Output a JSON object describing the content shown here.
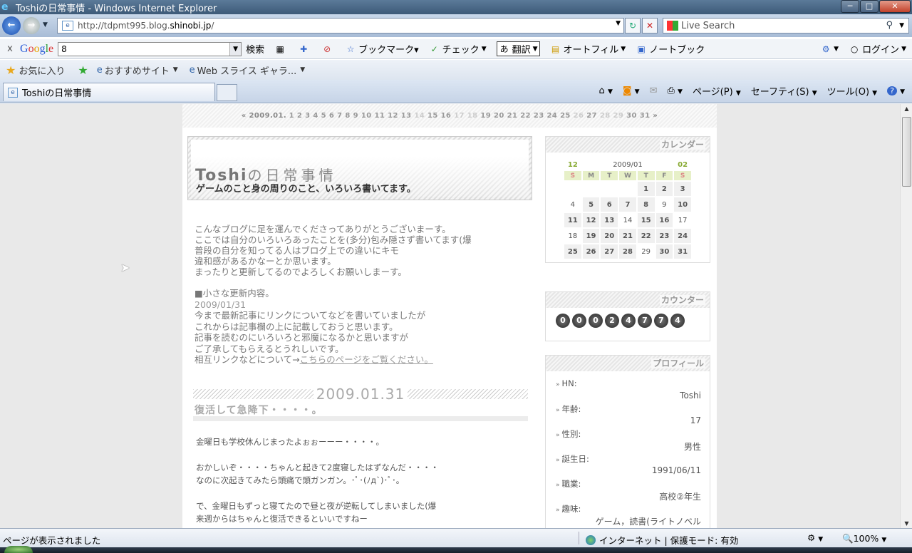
{
  "window": {
    "title": "Toshiの日常事情 - Windows Internet Explorer",
    "minimize": "─",
    "maximize": "□",
    "close": "✕"
  },
  "nav": {
    "url_prefix": "http://tdpmt995.blog.",
    "url_domain": "shinobi.jp",
    "url_suffix": "/",
    "search_placeholder": "Live Search"
  },
  "google_toolbar": {
    "close": "x",
    "select_value": "8",
    "search_label": "検索",
    "bookmark": "ブックマーク▾",
    "check": "チェック",
    "translate": "翻訳",
    "autofill": "オートフィル",
    "notebook": "ノートブック",
    "login": "ログイン"
  },
  "favorites": {
    "favorites_label": "お気に入り",
    "suggested_sites": "おすすめサイト",
    "web_slice": "Web スライス ギャラ..."
  },
  "tab": {
    "label": "Toshiの日常事情"
  },
  "command_bar": {
    "page": "ページ(P)",
    "safety": "セーフティ(S)",
    "tools": "ツール(O)"
  },
  "blog": {
    "date_nav_prefix": "« 2009.01.",
    "date_nav_days": [
      "1",
      "2",
      "3",
      "4",
      "5",
      "6",
      "7",
      "8",
      "9",
      "10",
      "11",
      "12",
      "13",
      "14",
      "15",
      "16",
      "17",
      "18",
      "19",
      "20",
      "21",
      "22",
      "23",
      "24",
      "25",
      "26",
      "27",
      "28",
      "29",
      "30",
      "31"
    ],
    "date_nav_suffix": "»",
    "title_main": "Toshi",
    "title_rest": "の日常事情",
    "subtitle": "ゲームのこと身の周りのこと、いろいろ書いてます。",
    "intro": [
      "こんなブログに足を運んでくださってありがとうございまーす。",
      "ここでは自分のいろいろあったことを(多分)包み隠さず書いてます(爆",
      "普段の自分を知ってる人はブログ上での違いにキモ",
      "違和感があるかなーとか思います。",
      "まったりと更新してるのでよろしくお願いしまーす。"
    ],
    "updates_heading": "■小さな更新内容。",
    "updates_date": "2009/01/31",
    "updates_lines": [
      "今まで最新記事にリンクについてなどを書いていましたが",
      "これからは記事欄の上に記載しておうと思います。",
      "記事を読むのにいろいろと邪魔になるかと思いますが",
      "ご了承してもらえるとうれしいです。"
    ],
    "updates_link_prefix": "相互リンクなどについて→",
    "updates_link": "こちらのページをご覧ください。",
    "post_date": "2009.01.31",
    "post_title": "復活して急降下・・・・。",
    "post_body": [
      "金曜日も学校休んじまったよぉぉーーー・・・・。",
      "",
      "おかしいぞ・・・・ちゃんと起きて2度寝したはずなんだ・・・・",
      "なのに次起きてみたら頭痛で頭ガンガン。･ﾟ･(ﾉд`)･ﾟ･。",
      "",
      "で、金曜日もずっと寝てたので昼と夜が逆転してしまいました(爆",
      "来週からはちゃんと復活できるといいですねー"
    ]
  },
  "calendar": {
    "heading": "カレンダー",
    "prev": "12",
    "month": "2009/01",
    "next": "02",
    "dow": [
      "S",
      "M",
      "T",
      "W",
      "T",
      "F",
      "S"
    ],
    "weeks": [
      [
        "",
        "",
        "",
        "",
        "1",
        "2",
        "3"
      ],
      [
        "4",
        "5",
        "6",
        "7",
        "8",
        "9",
        "10"
      ],
      [
        "11",
        "12",
        "13",
        "14",
        "15",
        "16",
        "17"
      ],
      [
        "18",
        "19",
        "20",
        "21",
        "22",
        "23",
        "24"
      ],
      [
        "25",
        "26",
        "27",
        "28",
        "29",
        "30",
        "31"
      ]
    ]
  },
  "counter": {
    "heading": "カウンター",
    "digits": [
      "0",
      "0",
      "0",
      "2",
      "4",
      "7",
      "7",
      "4"
    ]
  },
  "profile": {
    "heading": "プロフィール",
    "fields": [
      {
        "key": "HN:",
        "value": "Toshi"
      },
      {
        "key": "年齢:",
        "value": "17"
      },
      {
        "key": "性別:",
        "value": "男性"
      },
      {
        "key": "誕生日:",
        "value": "1991/06/11"
      },
      {
        "key": "職業:",
        "value": "高校②年生"
      },
      {
        "key": "趣味:",
        "value": "ゲーム，読書(ライトノベル"
      }
    ]
  },
  "status": {
    "message": "ページが表示されました",
    "zone": "インターネット | 保護モード: 有効",
    "zoom": "100%"
  },
  "colors": {
    "titlebar": "#3d5a78",
    "accent": "#2a5bd7",
    "calendar_nav": "#88aa33"
  }
}
